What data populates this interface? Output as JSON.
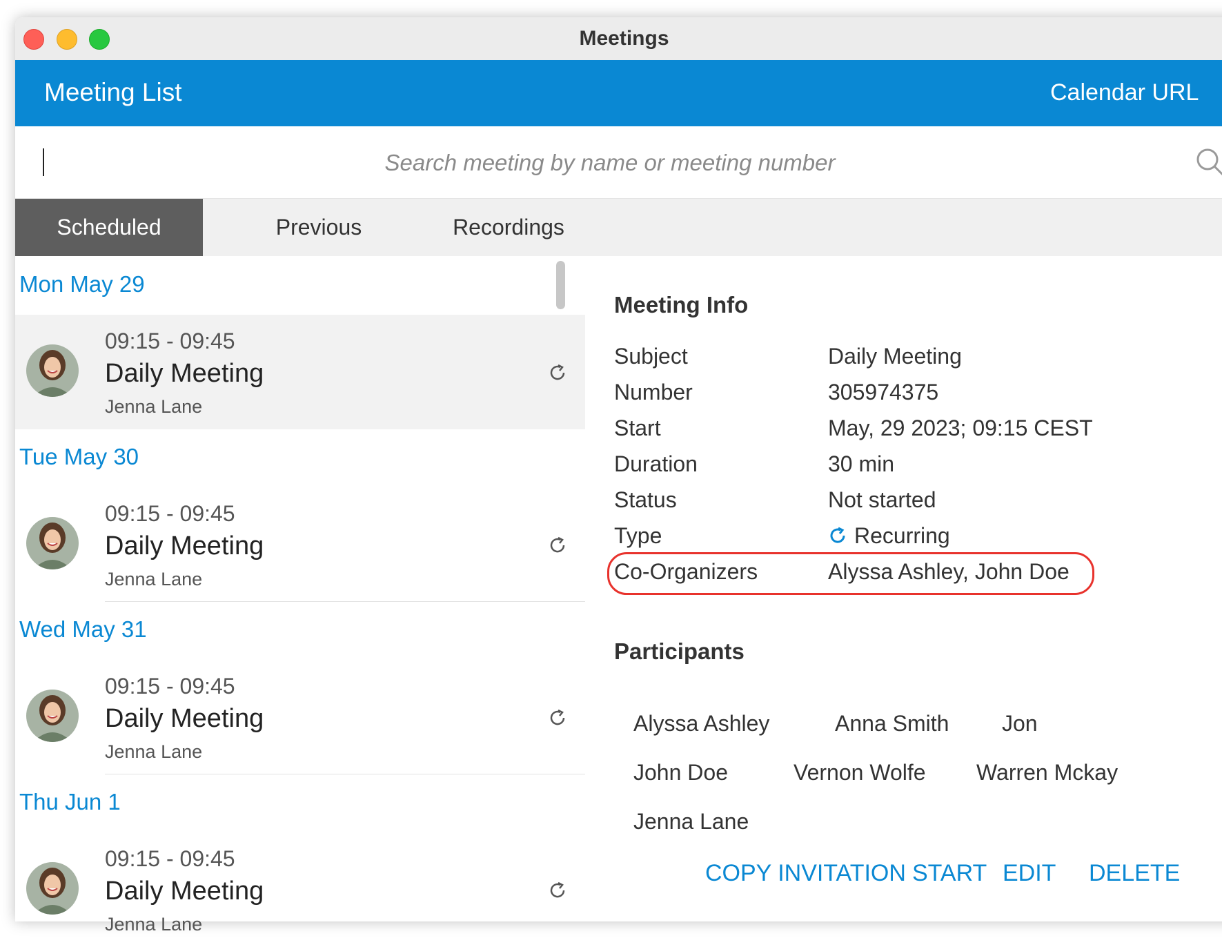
{
  "window": {
    "title": "Meetings"
  },
  "header": {
    "title": "Meeting List",
    "calendar_url": "Calendar URL"
  },
  "search": {
    "placeholder": "Search meeting by name or meeting number"
  },
  "tabs": [
    {
      "label": "Scheduled",
      "active": true
    },
    {
      "label": "Previous",
      "active": false
    },
    {
      "label": "Recordings",
      "active": false
    }
  ],
  "days": [
    {
      "label": "Mon May 29",
      "meeting": {
        "time": "09:15 - 09:45",
        "title": "Daily Meeting",
        "organizer": "Jenna Lane",
        "icon": "recurring-icon",
        "selected": true
      }
    },
    {
      "label": "Tue May 30",
      "meeting": {
        "time": "09:15 - 09:45",
        "title": "Daily Meeting",
        "organizer": "Jenna Lane",
        "icon": "recurring-icon",
        "selected": false
      }
    },
    {
      "label": "Wed May 31",
      "meeting": {
        "time": "09:15 - 09:45",
        "title": "Daily Meeting",
        "organizer": "Jenna Lane",
        "icon": "recurring-icon",
        "selected": false
      }
    },
    {
      "label": "Thu Jun 1",
      "meeting": {
        "time": "09:15 - 09:45",
        "title": "Daily Meeting",
        "organizer": "Jenna Lane",
        "icon": "recurring-icon",
        "selected": false
      }
    }
  ],
  "meeting_info": {
    "heading": "Meeting Info",
    "fields": [
      {
        "label": "Subject",
        "value": "Daily Meeting"
      },
      {
        "label": "Number",
        "value": "305974375"
      },
      {
        "label": "Start",
        "value": "May, 29 2023; 09:15 CEST"
      },
      {
        "label": "Duration",
        "value": "30 min"
      },
      {
        "label": "Status",
        "value": "Not started"
      },
      {
        "label": "Type",
        "value": "Recurring"
      },
      {
        "label": "Co-Organizers",
        "value": "Alyssa Ashley, John Doe"
      }
    ]
  },
  "participants": {
    "heading": "Participants",
    "names": [
      "Alyssa Ashley",
      "Anna Smith",
      "Jon",
      "John Doe",
      "Vernon Wolfe",
      "Warren Mckay",
      "Jenna Lane"
    ]
  },
  "actions": {
    "copy_invitation": "COPY INVITATION",
    "start": "START",
    "edit": "EDIT",
    "delete": "DELETE"
  },
  "colors": {
    "accent": "#0a88d3",
    "tab_active": "#5e5e5e",
    "highlight": "#e8322c"
  }
}
